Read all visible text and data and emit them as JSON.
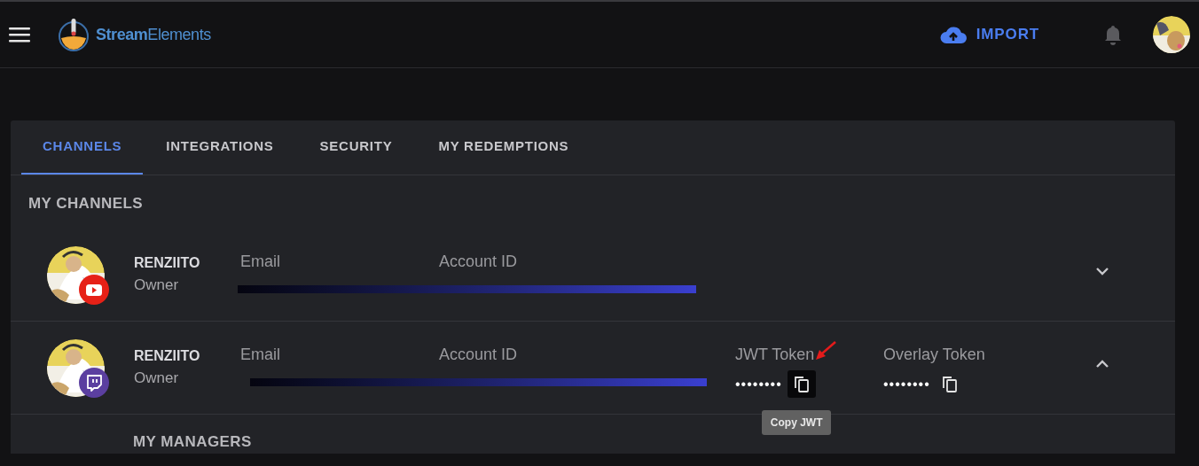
{
  "header": {
    "brand_bold": "Stream",
    "brand_light": "Elements",
    "import_label": "IMPORT"
  },
  "tabs": [
    {
      "label": "CHANNELS",
      "selected": true
    },
    {
      "label": "INTEGRATIONS",
      "selected": false
    },
    {
      "label": "SECURITY",
      "selected": false
    },
    {
      "label": "MY REDEMPTIONS",
      "selected": false
    }
  ],
  "section_title": "MY CHANNELS",
  "channels": [
    {
      "name": "RENZIITO",
      "role": "Owner",
      "kind": "youtube",
      "email_label": "Email",
      "account_label": "Account ID",
      "expanded": false
    },
    {
      "name": "RENZIITO",
      "role": "Owner",
      "kind": "twitch",
      "email_label": "Email",
      "account_label": "Account ID",
      "expanded": true,
      "tokens": [
        {
          "label": "JWT Token",
          "value": "••••••••",
          "hovered": true,
          "tooltip": "Copy JWT"
        },
        {
          "label": "Overlay Token",
          "value": "••••••••",
          "hovered": false
        }
      ]
    }
  ],
  "managers_title": "MY MANAGERS"
}
